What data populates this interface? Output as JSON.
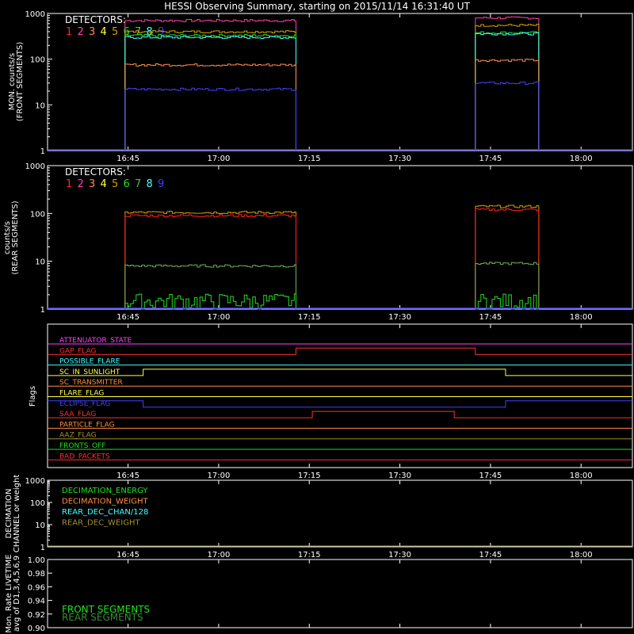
{
  "title": "HESSI Observing Summary, starting on 2015/11/14 16:31:40 UT",
  "time_ticks": [
    "16:45",
    "17:00",
    "17:15",
    "17:30",
    "17:45",
    "18:00"
  ],
  "time_tick_minutes": [
    45,
    60,
    75,
    90,
    105,
    120
  ],
  "time_range_minutes": [
    31.67,
    128.5
  ],
  "colors": {
    "det1": "#ff2020",
    "det2": "#ff40a0",
    "det3": "#ff8c40",
    "det4": "#ffff40",
    "det5": "#d0a000",
    "det6": "#20e020",
    "det7": "#6ab05a",
    "det8": "#40ffff",
    "det9": "#4040ff",
    "magenta": "#ff40ff"
  },
  "panel_front": {
    "ylabel_1": "MON. counts/s",
    "ylabel_2": "(FRONT SEGMENTS)",
    "yticks": [
      "1",
      "10",
      "100",
      "1000"
    ],
    "legend_title": "DETECTORS:",
    "legend_digits": [
      "1",
      "2",
      "3",
      "4",
      "5",
      "6",
      "7",
      "8",
      "9"
    ]
  },
  "panel_rear": {
    "ylabel_1": "counts/s",
    "ylabel_2": "(REAR SEGMENTS)",
    "yticks": [
      "1",
      "10",
      "100",
      "1000"
    ],
    "legend_title": "DETECTORS:",
    "legend_digits": [
      "1",
      "2",
      "3",
      "4",
      "5",
      "6",
      "7",
      "8",
      "9"
    ]
  },
  "panel_flags": {
    "ylabel": "Flags",
    "flags": [
      {
        "label": "ATTENUATOR_STATE",
        "color": "#ff40ff"
      },
      {
        "label": "GAP_FLAG",
        "color": "#ff3030"
      },
      {
        "label": "POSSIBLE_FLARE",
        "color": "#40ffff"
      },
      {
        "label": "SC_IN_SUNLIGHT",
        "color": "#ffff40"
      },
      {
        "label": "SC_TRANSMITTER",
        "color": "#ff8c40"
      },
      {
        "label": "FLARE_FLAG",
        "color": "#ffff40"
      },
      {
        "label": "ECLIPSE_FLAG",
        "color": "#4040ff"
      },
      {
        "label": "SAA_FLAG",
        "color": "#ff3030"
      },
      {
        "label": "PARTICLE_FLAG",
        "color": "#ff8c40"
      },
      {
        "label": "AAZ_FLAG",
        "color": "#a09030"
      },
      {
        "label": "FRONTS_OFF",
        "color": "#20e020"
      },
      {
        "label": "BAD_PACKETS",
        "color": "#ff3030"
      }
    ]
  },
  "panel_decimation": {
    "ylabel_1": "DECIMATION",
    "ylabel_2": "CHANNEL or weight",
    "yticks": [
      "1",
      "10",
      "100",
      "1000"
    ],
    "legend": [
      {
        "label": "DECIMATION_ENERGY",
        "color": "#20e020"
      },
      {
        "label": "DECIMATION_WEIGHT",
        "color": "#ff8c40"
      },
      {
        "label": "REAR_DEC_CHAN/128",
        "color": "#40ffff"
      },
      {
        "label": "REAR_DEC_WEIGHT",
        "color": "#a09030"
      }
    ]
  },
  "panel_livetime": {
    "ylabel_1": "Mon. Rate LIVETIME",
    "ylabel_2": "avg of D1,3,4,5,6,9",
    "yticks": [
      "0.90",
      "0.92",
      "0.94",
      "0.96",
      "0.98",
      "1.00"
    ],
    "legend": [
      {
        "label": "FRONT SEGMENTS",
        "color": "#20e020"
      },
      {
        "label": "REAR SEGMENTS",
        "color": "#3a8a3a"
      }
    ]
  },
  "chart_data": [
    {
      "type": "line",
      "title": "HESSI Observing Summary, starting on 2015/11/14 16:31:40 UT",
      "ylabel": "MON. counts/s (FRONT SEGMENTS)",
      "yscale": "log",
      "ylim": [
        1,
        1000
      ],
      "x_units": "minutes after 16:00 UT",
      "series": [
        {
          "name": "2",
          "segments": [
            [
              44.5,
              72.8,
              700
            ],
            [
              102.5,
              113,
              800
            ]
          ]
        },
        {
          "name": "5",
          "segments": [
            [
              44.5,
              72.8,
              400
            ],
            [
              102.5,
              113,
              550
            ]
          ]
        },
        {
          "name": "6",
          "segments": [
            [
              44.5,
              72.8,
              330
            ],
            [
              102.5,
              113,
              380
            ]
          ]
        },
        {
          "name": "8",
          "segments": [
            [
              44.5,
              72.8,
              300
            ],
            [
              102.5,
              113,
              360
            ]
          ]
        },
        {
          "name": "3",
          "segments": [
            [
              44.5,
              72.8,
              75
            ],
            [
              102.5,
              113,
              95
            ]
          ]
        },
        {
          "name": "9",
          "segments": [
            [
              44.5,
              72.8,
              22
            ],
            [
              102.5,
              113,
              30
            ]
          ]
        }
      ]
    },
    {
      "type": "line",
      "ylabel": "counts/s (REAR SEGMENTS)",
      "yscale": "log",
      "ylim": [
        1,
        1000
      ],
      "x_units": "minutes after 16:00 UT",
      "series": [
        {
          "name": "5",
          "segments": [
            [
              44.5,
              72.8,
              105
            ],
            [
              102.5,
              113,
              140
            ]
          ]
        },
        {
          "name": "1",
          "segments": [
            [
              44.5,
              72.8,
              90
            ],
            [
              102.5,
              113,
              120
            ]
          ]
        },
        {
          "name": "7",
          "segments": [
            [
              44.5,
              72.8,
              8
            ],
            [
              102.5,
              113,
              9
            ]
          ]
        },
        {
          "name": "6",
          "segments": [
            [
              44.5,
              72.8,
              1.5
            ],
            [
              102.5,
              113,
              1.5
            ]
          ]
        }
      ]
    },
    {
      "type": "line",
      "ylabel": "Flags",
      "x_units": "minutes after 16:00 UT",
      "step_times": {
        "GAP_FLAG": [
          [
            72.8,
            102.5,
            "high"
          ]
        ],
        "SC_IN_SUNLIGHT": [
          [
            47.5,
            107.5,
            "high"
          ]
        ],
        "ECLIPSE_FLAG": [
          [
            47.5,
            107.5,
            "high"
          ]
        ],
        "SAA_FLAG": [
          [
            75.5,
            99,
            "high"
          ]
        ]
      }
    },
    {
      "type": "line",
      "ylabel": "DECIMATION CHANNEL or weight",
      "yscale": "log",
      "ylim": [
        1,
        1000
      ]
    },
    {
      "type": "line",
      "ylabel": "Mon. Rate LIVETIME avg of D1,3,4,5,6,9",
      "ylim": [
        0.9,
        1.0
      ]
    }
  ]
}
